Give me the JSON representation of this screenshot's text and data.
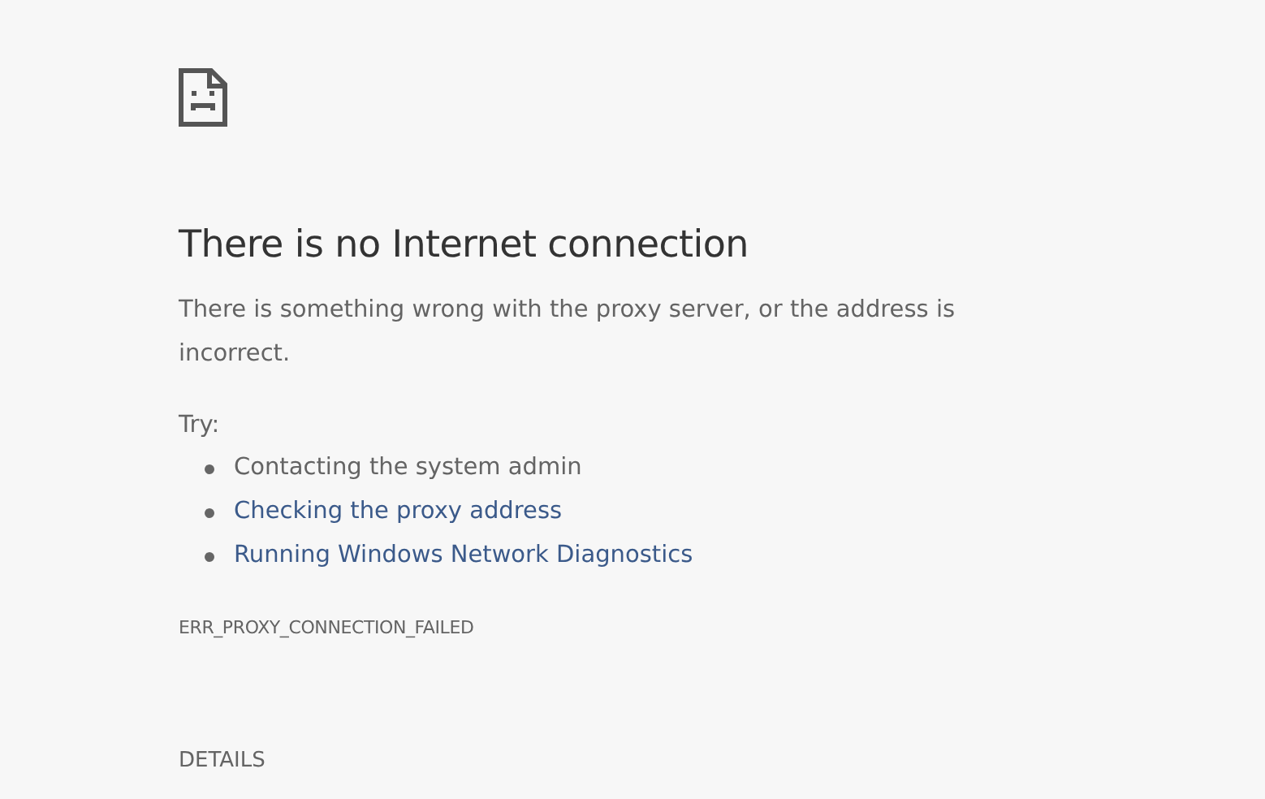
{
  "heading": "There is no Internet connection",
  "message": "There is something wrong with the proxy server, or the address is incorrect.",
  "try_label": "Try:",
  "suggestions": [
    {
      "text": "Contacting the system admin",
      "kind": "text"
    },
    {
      "text": "Checking the proxy address",
      "kind": "link"
    },
    {
      "text": "Running Windows Network Diagnostics",
      "kind": "link"
    }
  ],
  "error_code": "ERR_PROXY_CONNECTION_FAILED",
  "details_button": "DETAILS"
}
